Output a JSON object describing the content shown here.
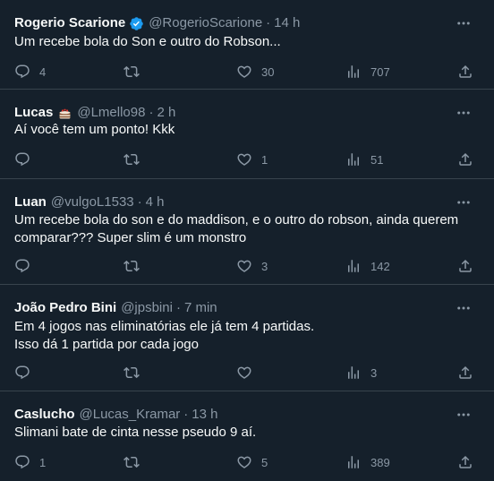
{
  "colors": {
    "background": "#15202b",
    "text": "#f7f9f9",
    "secondary": "#8b98a5",
    "divider": "#38444d",
    "verified": "#1d9bf0"
  },
  "tweets": [
    {
      "name": "Rogerio Scarione",
      "verified": true,
      "handle": "@RogerioScarione",
      "time": "14 h",
      "text": [
        "Um recebe bola do Son e outro do Robson..."
      ],
      "replies": "4",
      "retweets": "",
      "likes": "30",
      "views": "707"
    },
    {
      "name": "Lucas",
      "emoji": "cake-icon",
      "handle": "@Lmello98",
      "time": "2 h",
      "text": [
        "Aí você tem um ponto! Kkk"
      ],
      "replies": "",
      "retweets": "",
      "likes": "1",
      "views": "51"
    },
    {
      "name": "Luan",
      "handle": "@vulgoL1533",
      "time": "4 h",
      "text": [
        "Um recebe bola do son e do maddison, e o outro do robson, ainda querem comparar??? Super slim é um monstro"
      ],
      "replies": "",
      "retweets": "",
      "likes": "3",
      "views": "142"
    },
    {
      "name": "João Pedro Bini",
      "handle": "@jpsbini",
      "time": "7 min",
      "text": [
        "Em 4 jogos nas eliminatórias ele já tem 4 partidas.",
        "Isso dá 1 partida por cada jogo"
      ],
      "replies": "",
      "retweets": "",
      "likes": "",
      "views": "3"
    },
    {
      "name": "Caslucho",
      "handle": "@Lucas_Kramar",
      "time": "13 h",
      "text": [
        "Slimani bate de cinta nesse pseudo 9 aí."
      ],
      "replies": "1",
      "retweets": "",
      "likes": "5",
      "views": "389"
    }
  ]
}
